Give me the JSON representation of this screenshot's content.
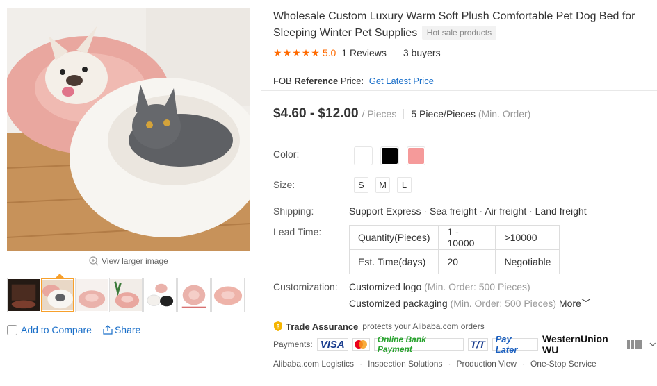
{
  "gallery": {
    "view_larger": "View larger image",
    "thumbnail_count": 7,
    "active_thumbnail": 2
  },
  "actions": {
    "compare": "Add to Compare",
    "share": "Share"
  },
  "product": {
    "title": "Wholesale Custom Luxury Warm Soft Plush Comfortable Pet Dog Bed for Sleeping Winter Pet Supplies",
    "badge": "Hot sale products",
    "rating": "5.0",
    "stars": 5,
    "reviews": "1 Reviews",
    "buyers": "3 buyers"
  },
  "fob": {
    "prefix": "FOB",
    "bold": "Reference",
    "suffix": "Price:",
    "link": "Get Latest Price"
  },
  "price": {
    "range": "$4.60 - $12.00",
    "unit": "/ Pieces",
    "moq": "5 Piece/Pieces",
    "moq_label": "(Min. Order)"
  },
  "attributes": {
    "color_label": "Color:",
    "colors": [
      "#ffffff",
      "#000000",
      "#f59a9a"
    ],
    "size_label": "Size:",
    "sizes": [
      "S",
      "M",
      "L"
    ],
    "shipping_label": "Shipping:",
    "shipping": "Support Express · Sea freight · Air freight · Land freight",
    "lead_label": "Lead Time:",
    "lead_table": [
      [
        "Quantity(Pieces)",
        "1 - 10000",
        ">10000"
      ],
      [
        "Est. Time(days)",
        "20",
        "Negotiable"
      ]
    ],
    "custom_label": "Customization:",
    "custom_logo": "Customized logo",
    "custom_logo_min": "(Min. Order: 500 Pieces)",
    "custom_pack": "Customized packaging",
    "custom_pack_min": "(Min. Order: 500 Pieces)",
    "more": "More"
  },
  "trade": {
    "title": "Trade Assurance",
    "desc": "protects your Alibaba.com orders"
  },
  "payments": {
    "label": "Payments:",
    "visa": "VISA",
    "obp": "Online Bank Payment",
    "tt": "T/T",
    "paylater": "Pay Later",
    "wu": "WesternUnion WU"
  },
  "services": [
    "Alibaba.com Logistics",
    "Inspection Solutions",
    "Production View",
    "One-Stop Service"
  ],
  "colors": {
    "accent": "#ff6a00",
    "link": "#1a6fc9",
    "thumb_active": "#f7a02c"
  }
}
